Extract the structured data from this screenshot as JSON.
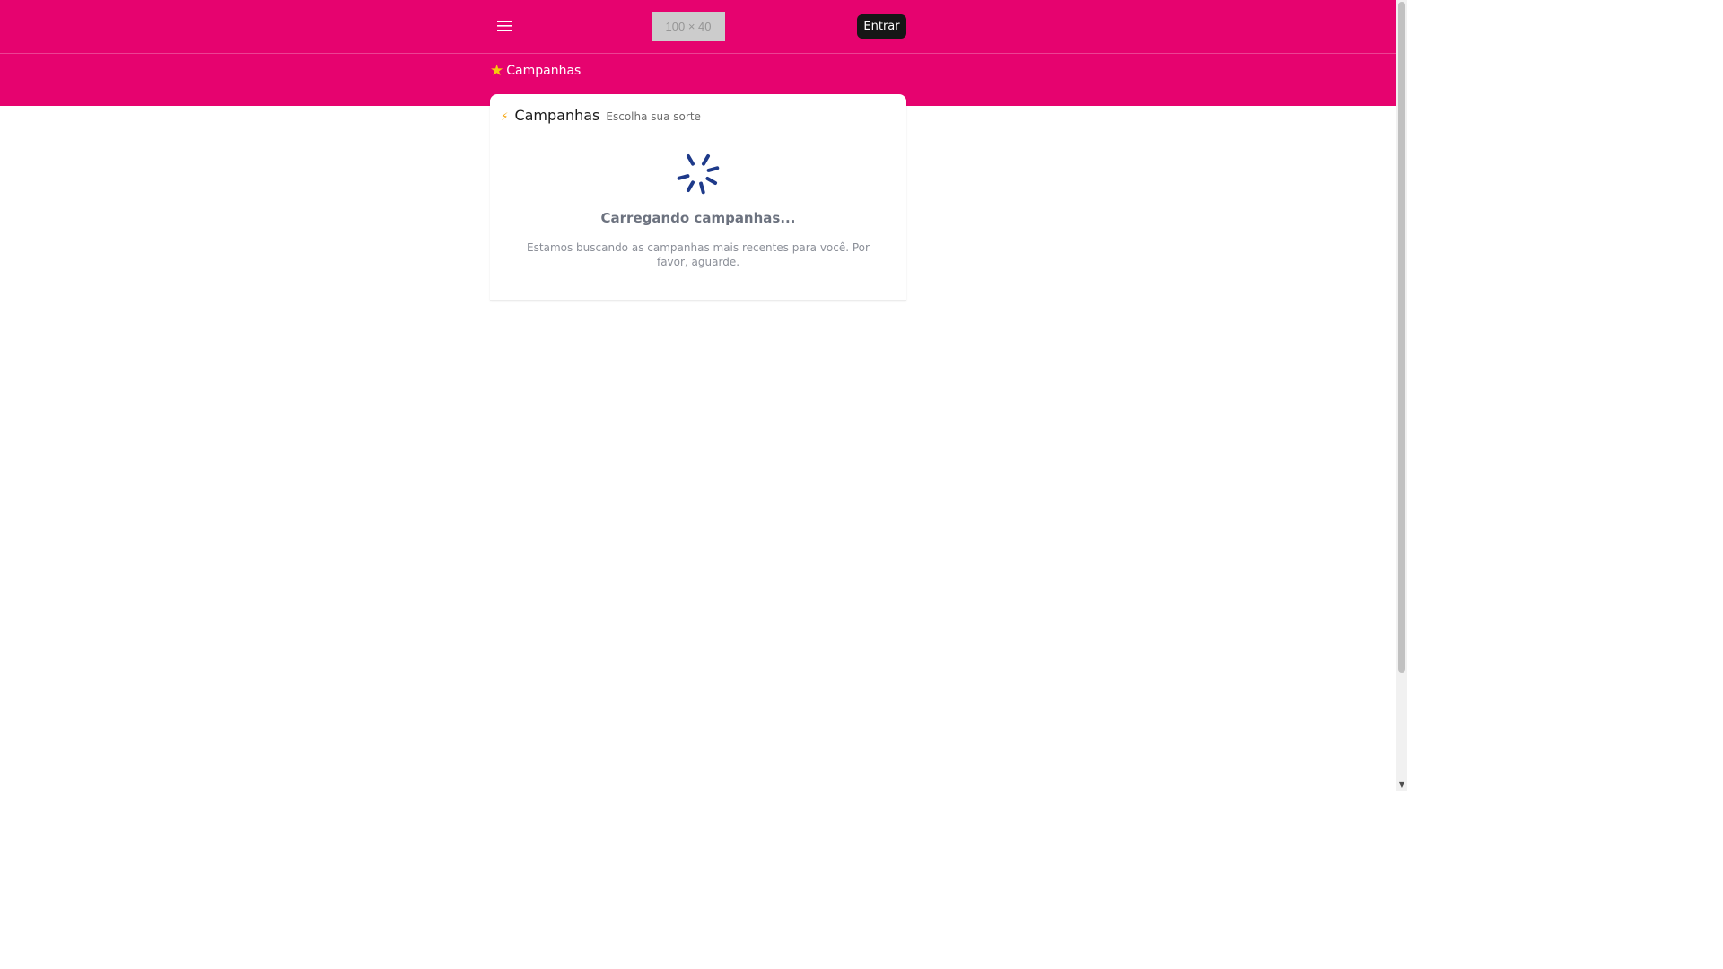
{
  "header": {
    "logo_placeholder": "100 × 40",
    "login_label": "Entrar"
  },
  "breadcrumb": {
    "label": "Campanhas",
    "icon": "star-icon"
  },
  "card": {
    "title": "Campanhas",
    "subtitle": "Escolha sua sorte",
    "icon": "lightning-icon",
    "loading_title": "Carregando campanhas...",
    "loading_description": "Estamos buscando as campanhas mais recentes para você. Por favor, aguarde."
  },
  "colors": {
    "brand": "#e6036f",
    "spinner": "#1e3a8a",
    "button": "#161616"
  }
}
